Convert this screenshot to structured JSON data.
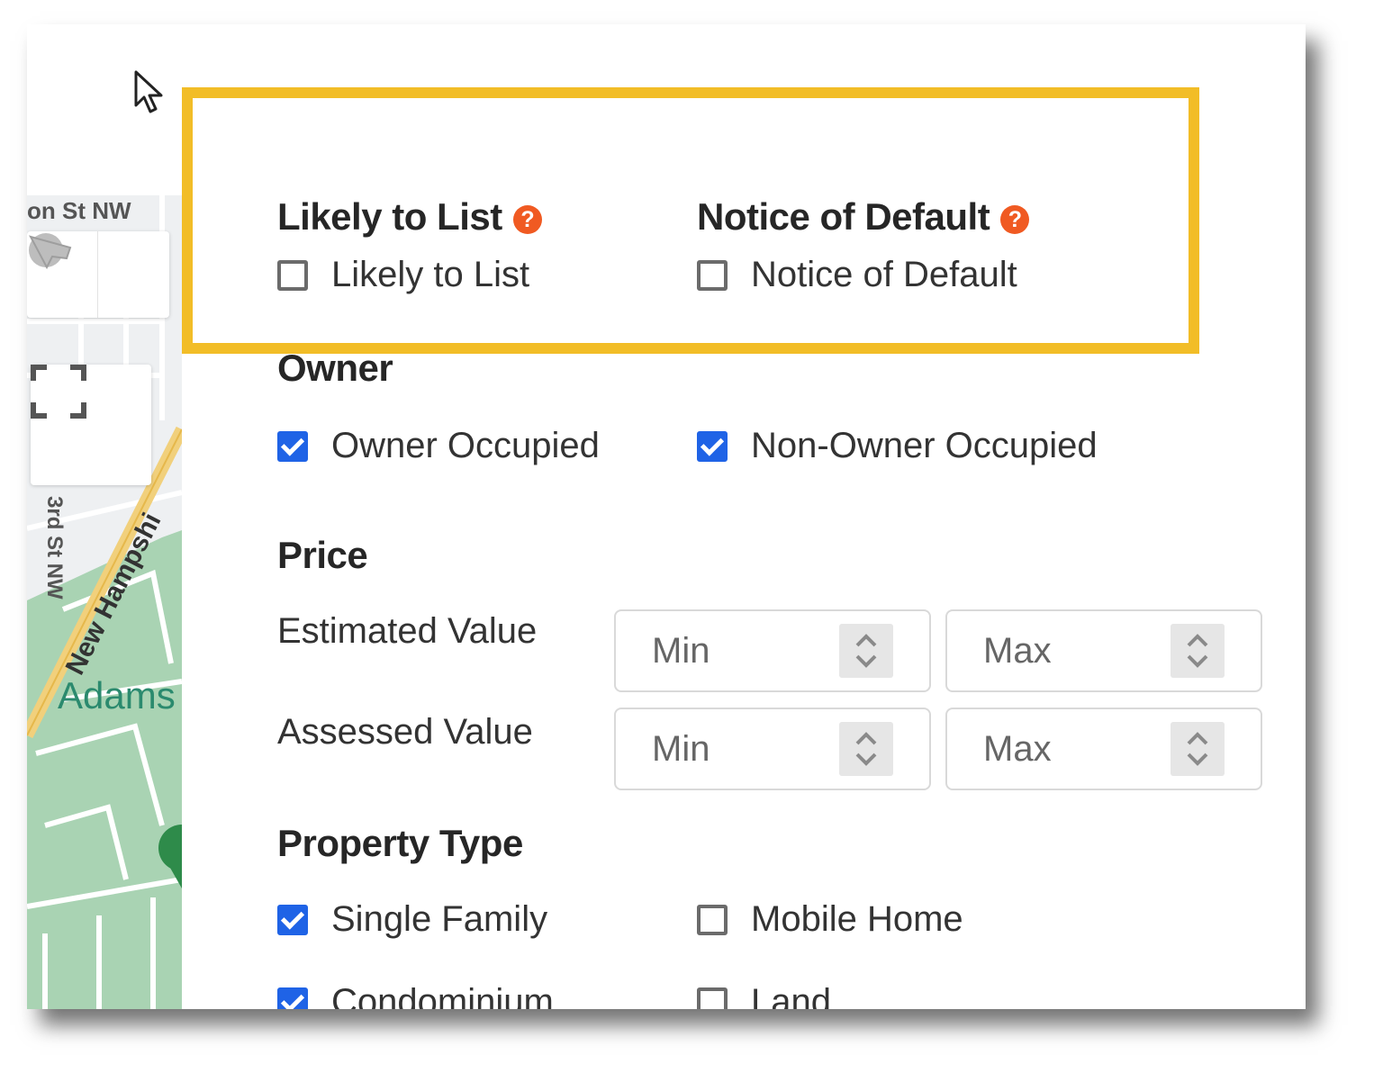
{
  "map": {
    "labels": {
      "street_top": "on St NW",
      "street_side": "3rd St NW",
      "avenue": "New Hampshi",
      "park": "Adams"
    },
    "icons": [
      "circle-draw-icon",
      "polygon-draw-icon",
      "fullscreen-icon",
      "cursor-icon",
      "map-pin-icon"
    ]
  },
  "colors": {
    "highlight": "#f2bd27",
    "checkbox_checked": "#1f63e6",
    "help_icon": "#f05a22"
  },
  "filters": {
    "likely_to_list": {
      "heading": "Likely to List",
      "help": "?",
      "checkbox_label": "Likely to List",
      "checked": false
    },
    "notice_of_default": {
      "heading": "Notice of Default",
      "help": "?",
      "checkbox_label": "Notice of Default",
      "checked": false
    },
    "owner": {
      "heading": "Owner",
      "options": [
        {
          "label": "Owner Occupied",
          "checked": true
        },
        {
          "label": "Non-Owner Occupied",
          "checked": true
        }
      ]
    },
    "price": {
      "heading": "Price",
      "rows": [
        {
          "label": "Estimated Value",
          "min_placeholder": "Min",
          "max_placeholder": "Max"
        },
        {
          "label": "Assessed Value",
          "min_placeholder": "Min",
          "max_placeholder": "Max"
        }
      ]
    },
    "property_type": {
      "heading": "Property Type",
      "options": [
        {
          "label": "Single Family",
          "checked": true
        },
        {
          "label": "Mobile Home",
          "checked": false
        },
        {
          "label": "Condominium",
          "checked": true
        },
        {
          "label": "Land",
          "checked": false
        }
      ]
    }
  }
}
